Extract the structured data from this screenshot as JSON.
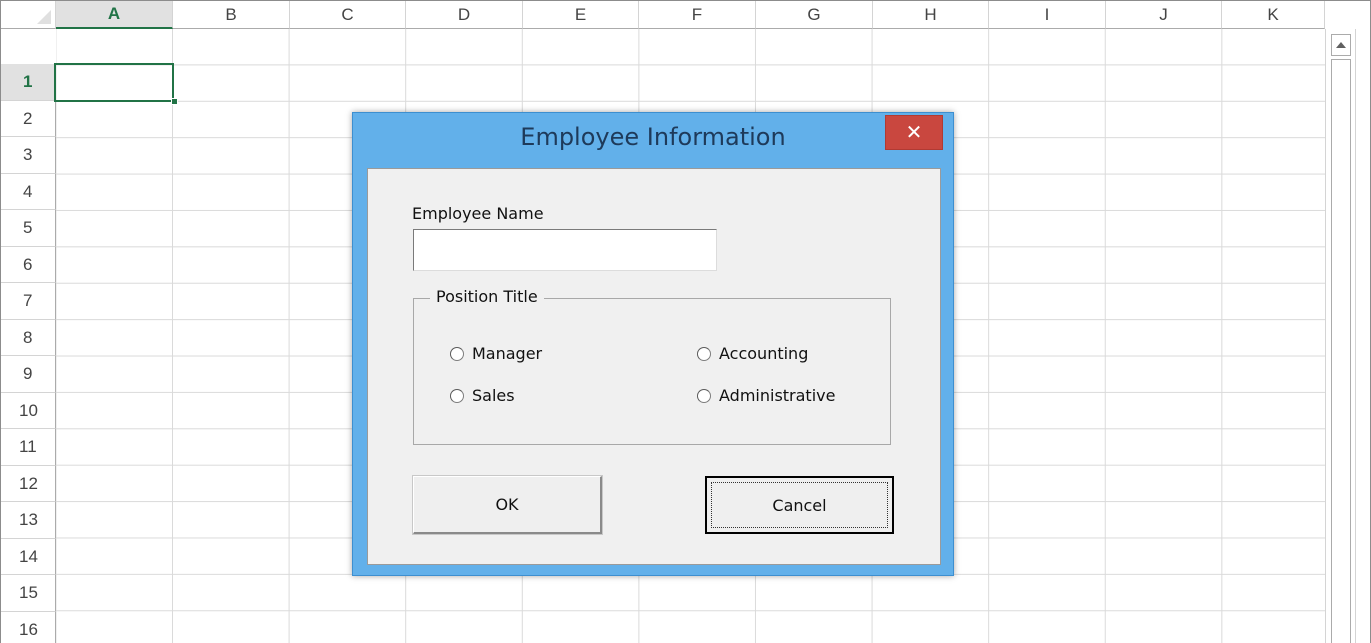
{
  "spreadsheet": {
    "columns": [
      "A",
      "B",
      "C",
      "D",
      "E",
      "F",
      "G",
      "H",
      "I",
      "J",
      "K"
    ],
    "rows": [
      "1",
      "2",
      "3",
      "4",
      "5",
      "6",
      "7",
      "8",
      "9",
      "10",
      "11",
      "12",
      "13",
      "14",
      "15",
      "16"
    ],
    "active_cell": "A1",
    "accent_color": "#217346"
  },
  "dialog": {
    "title": "Employee Information",
    "close_glyph": "✕",
    "name_label": "Employee Name",
    "name_value": "",
    "position_group_label": "Position Title",
    "options": {
      "manager": "Manager",
      "accounting": "Accounting",
      "sales": "Sales",
      "administrative": "Administrative"
    },
    "ok_label": "OK",
    "cancel_label": "Cancel",
    "title_bar_color": "#62b0ea",
    "close_button_color": "#c9473f"
  }
}
